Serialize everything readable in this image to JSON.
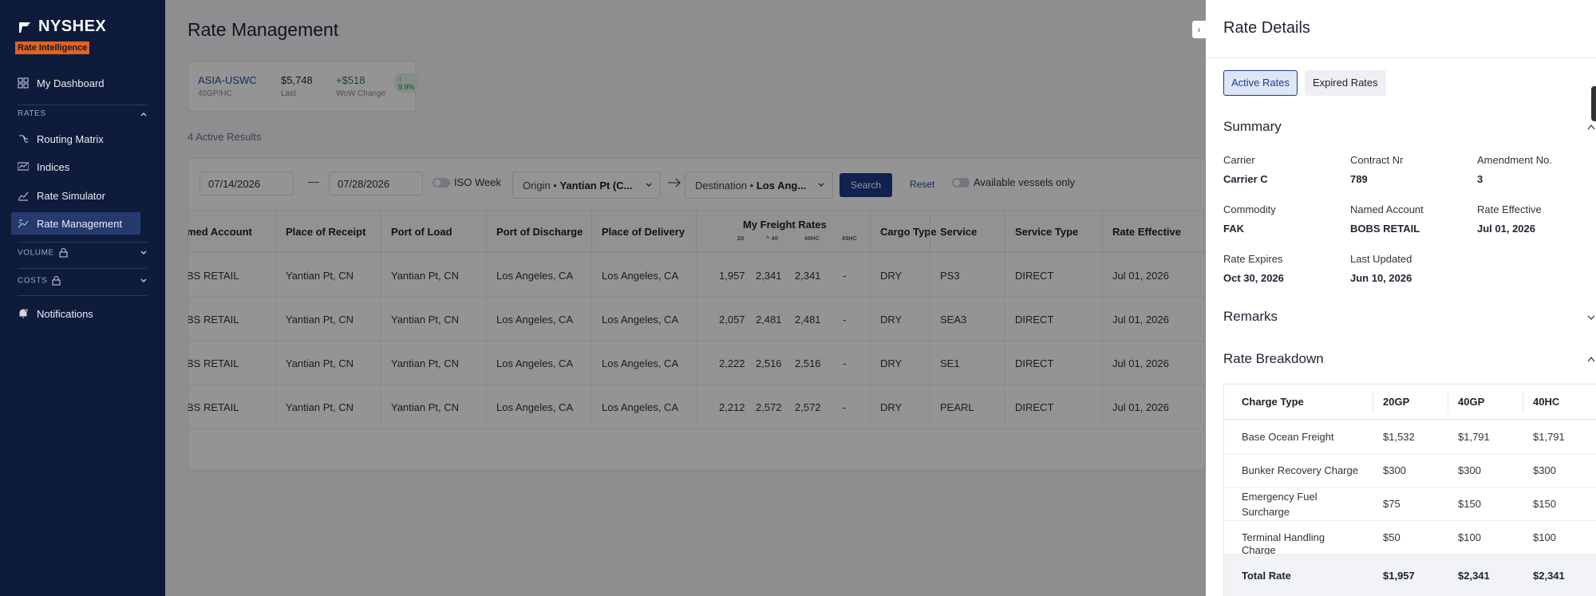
{
  "sidebar": {
    "brand": "NYSHEX",
    "badge": "Rate Intelligence",
    "dashboard": "My Dashboard",
    "rates_section": "RATES",
    "rates_items": [
      "Routing Matrix",
      "Indices",
      "Rate Simulator",
      "Rate Management"
    ],
    "volume_section": "VOLUME",
    "costs_section": "COSTS",
    "notifications": "Notifications"
  },
  "main": {
    "title": "Rate Management",
    "ticker": {
      "lane": "ASIA-USWC",
      "lane_sub": "40GP/HC",
      "price": "$5,748",
      "price_sub": "Last",
      "change": "+$518",
      "change_pct": "9.9%",
      "change_sub": "WoW Change"
    },
    "results_count": "4 Active Results",
    "filters": {
      "date_from": "07/14/2026",
      "date_dash": "—",
      "date_to": "07/28/2026",
      "iso_week": "ISO Week",
      "origin_label": "Origin •",
      "origin_value": "Yantian Pt (C...",
      "destination_label": "Destination •",
      "destination_value": "Los Ang...",
      "search": "Search",
      "reset": "Reset",
      "available_vessels": "Available vessels only"
    },
    "columns": [
      "med Account",
      "Place of Receipt",
      "Port of Load",
      "Port of Discharge",
      "Place of Delivery",
      "Cargo Type",
      "Service",
      "Service Type",
      "Rate Effective"
    ],
    "freight_header": "My Freight Rates",
    "freight_sub": [
      "20",
      "40",
      "40HC",
      "45HC"
    ],
    "rows": [
      {
        "account": "BS RETAIL",
        "receipt": "Yantian Pt, CN",
        "load": "Yantian Pt, CN",
        "discharge": "Los Angeles, CA",
        "delivery": "Los Angeles, CA",
        "r20": "1,957",
        "r40": "2,341",
        "r40hc": "2,341",
        "r45hc": "-",
        "cargo": "DRY",
        "service": "PS3",
        "stype": "DIRECT",
        "effective": "Jul 01, 2026"
      },
      {
        "account": "BS RETAIL",
        "receipt": "Yantian Pt, CN",
        "load": "Yantian Pt, CN",
        "discharge": "Los Angeles, CA",
        "delivery": "Los Angeles, CA",
        "r20": "2,057",
        "r40": "2,481",
        "r40hc": "2,481",
        "r45hc": "-",
        "cargo": "DRY",
        "service": "SEA3",
        "stype": "DIRECT",
        "effective": "Jul 01, 2026"
      },
      {
        "account": "BS RETAIL",
        "receipt": "Yantian Pt, CN",
        "load": "Yantian Pt, CN",
        "discharge": "Los Angeles, CA",
        "delivery": "Los Angeles, CA",
        "r20": "2,222",
        "r40": "2,516",
        "r40hc": "2,516",
        "r45hc": "-",
        "cargo": "DRY",
        "service": "SE1",
        "stype": "DIRECT",
        "effective": "Jul 01, 2026"
      },
      {
        "account": "BS RETAIL",
        "receipt": "Yantian Pt, CN",
        "load": "Yantian Pt, CN",
        "discharge": "Los Angeles, CA",
        "delivery": "Los Angeles, CA",
        "r20": "2,212",
        "r40": "2,572",
        "r40hc": "2,572",
        "r45hc": "-",
        "cargo": "DRY",
        "service": "PEARL",
        "stype": "DIRECT",
        "effective": "Jul 01, 2026"
      }
    ]
  },
  "drawer": {
    "close_glyph": "›",
    "title": "Rate Details",
    "tab_active": "Active Rates",
    "tab_expired": "Expired Rates",
    "summary_title": "Summary",
    "summary": {
      "carrier_label": "Carrier",
      "carrier": "Carrier C",
      "contract_label": "Contract Nr",
      "contract": "789",
      "amendment_label": "Amendment No.",
      "amendment": "3",
      "commodity_label": "Commodity",
      "commodity": "FAK",
      "named_account_label": "Named Account",
      "named_account": "BOBS RETAIL",
      "rate_effective_label": "Rate Effective",
      "rate_effective": "Jul 01, 2026",
      "rate_expires_label": "Rate Expires",
      "rate_expires": "Oct 30, 2026",
      "last_updated_label": "Last Updated",
      "last_updated": "Jun 10, 2026"
    },
    "remarks_title": "Remarks",
    "breakdown_title": "Rate Breakdown",
    "breakdown_cols": [
      "Charge Type",
      "20GP",
      "40GP",
      "40HC"
    ],
    "breakdown_rows": [
      {
        "type": "Base Ocean Freight",
        "c20": "$1,532",
        "c40": "$1,791",
        "c40hc": "$1,791"
      },
      {
        "type": "Bunker Recovery Charge",
        "c20": "$300",
        "c40": "$300",
        "c40hc": "$300"
      },
      {
        "type": "Emergency Fuel Surcharge",
        "c20": "$75",
        "c40": "$150",
        "c40hc": "$150"
      },
      {
        "type": "Terminal Handling Charge",
        "c20": "$50",
        "c40": "$100",
        "c40hc": "$100"
      }
    ],
    "total": {
      "type": "Total Rate",
      "c20": "$1,957",
      "c40": "$2,341",
      "c40hc": "$2,341"
    }
  },
  "colors": {
    "sidebar": "#0e1b3b",
    "accent": "#1e3a8a",
    "badge": "#e2631f"
  }
}
